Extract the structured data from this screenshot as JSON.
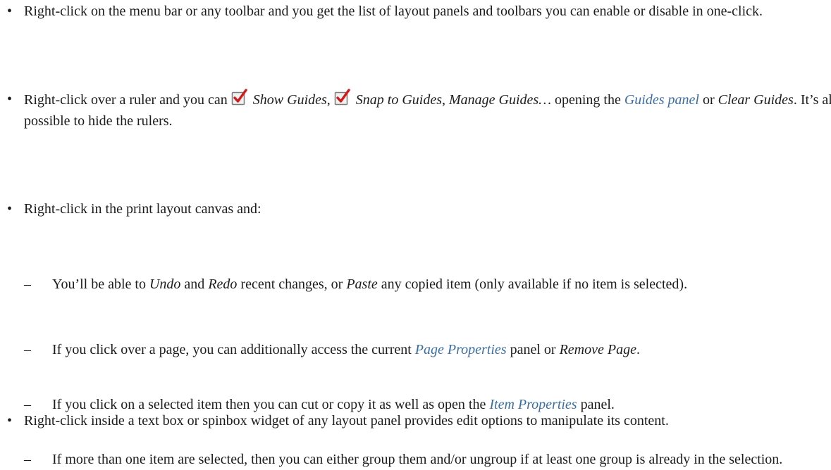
{
  "bullets": {
    "b1": "Right-click on the menu bar or any toolbar and you get the list of layout panels and toolbars you can enable or disable in one-click.",
    "b2": {
      "t1": "Right-click over a ruler and you can ",
      "show_guides": "Show Guides",
      "t2": ", ",
      "snap_guides": "Snap to Guides",
      "t3": ", ",
      "manage_guides": "Manage Guides…",
      "t4": " opening the ",
      "guides_panel_link": "Guides panel",
      "t5": " or ",
      "clear_guides": "Clear Guides",
      "t6": ". It’s also possible to hide the rulers."
    },
    "b3": "Right-click in the print layout canvas and:",
    "b4": "Right-click inside a text box or spinbox widget of any layout panel provides edit options to manipulate its content."
  },
  "sub": {
    "s1": {
      "t1": "You’ll be able to ",
      "undo": "Undo",
      "t2": " and ",
      "redo": "Redo",
      "t3": " recent changes, or ",
      "paste": "Paste",
      "t4": " any copied item (only available if no item is selected)."
    },
    "s2": {
      "t1": "If you click over a page, you can additionally access the current ",
      "page_properties_link": "Page Properties",
      "t2": " panel or ",
      "remove_page": "Remove Page",
      "t3": "."
    },
    "s3": {
      "t1": "If you click on a selected item then you can cut or copy it as well as open the ",
      "item_properties_link": "Item Properties",
      "t2": " panel."
    },
    "s4": "If more than one item are selected, then you can either group them and/or ungroup if at least one group is already in the selection."
  },
  "markers": {
    "bullet": "•",
    "dash": "–"
  },
  "colors": {
    "link": "#3a6ea5",
    "text": "#1c1c1c",
    "check_box": "#7b7b7b",
    "check_mark": "#d11a1a"
  },
  "icons": [
    "checkbox-checked-icon",
    "checkbox-checked-icon"
  ]
}
